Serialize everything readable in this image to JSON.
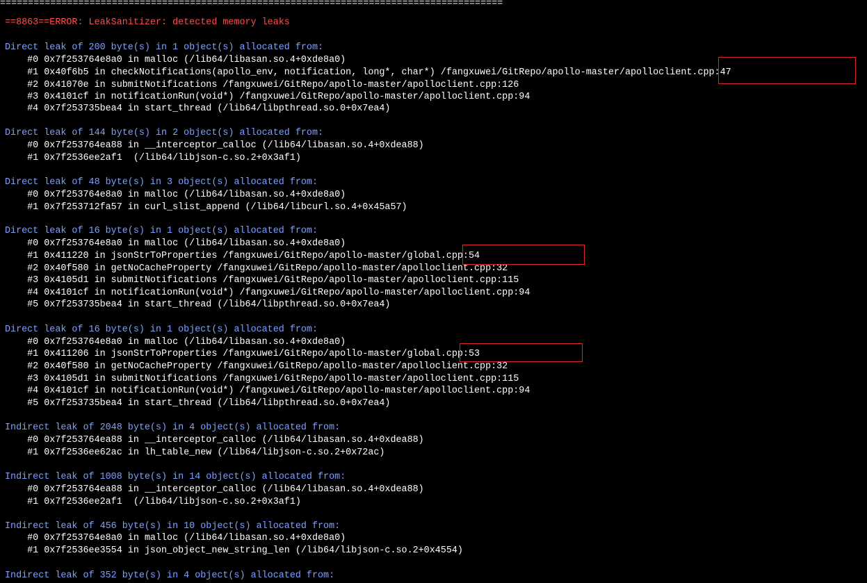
{
  "terminal": {
    "lines": [
      {
        "text": "==========================================================================================",
        "color": "white"
      },
      {
        "text": "==8863==ERROR: LeakSanitizer: detected memory leaks",
        "color": "red"
      },
      {
        "text": "",
        "color": "white"
      },
      {
        "text": "Direct leak of 200 byte(s) in 1 object(s) allocated from:",
        "color": "blue"
      },
      {
        "text": "    #0 0x7f253764e8a0 in malloc (/lib64/libasan.so.4+0xde8a0)",
        "color": "white"
      },
      {
        "text": "    #1 0x40f6b5 in checkNotifications(apollo_env, notification, long*, char*) /fangxuwei/GitRepo/apollo-master/apolloclient.cpp:47",
        "color": "white"
      },
      {
        "text": "    #2 0x41070e in submitNotifications /fangxuwei/GitRepo/apollo-master/apolloclient.cpp:126",
        "color": "white"
      },
      {
        "text": "    #3 0x4101cf in notificationRun(void*) /fangxuwei/GitRepo/apollo-master/apolloclient.cpp:94",
        "color": "white"
      },
      {
        "text": "    #4 0x7f253735bea4 in start_thread (/lib64/libpthread.so.0+0x7ea4)",
        "color": "white"
      },
      {
        "text": "",
        "color": "white"
      },
      {
        "text": "Direct leak of 144 byte(s) in 2 object(s) allocated from:",
        "color": "blue"
      },
      {
        "text": "    #0 0x7f253764ea88 in __interceptor_calloc (/lib64/libasan.so.4+0xdea88)",
        "color": "white"
      },
      {
        "text": "    #1 0x7f2536ee2af1  (/lib64/libjson-c.so.2+0x3af1)",
        "color": "white"
      },
      {
        "text": "",
        "color": "white"
      },
      {
        "text": "Direct leak of 48 byte(s) in 3 object(s) allocated from:",
        "color": "blue"
      },
      {
        "text": "    #0 0x7f253764e8a0 in malloc (/lib64/libasan.so.4+0xde8a0)",
        "color": "white"
      },
      {
        "text": "    #1 0x7f253712fa57 in curl_slist_append (/lib64/libcurl.so.4+0x45a57)",
        "color": "white"
      },
      {
        "text": "",
        "color": "white"
      },
      {
        "text": "Direct leak of 16 byte(s) in 1 object(s) allocated from:",
        "color": "blue"
      },
      {
        "text": "    #0 0x7f253764e8a0 in malloc (/lib64/libasan.so.4+0xde8a0)",
        "color": "white"
      },
      {
        "text": "    #1 0x411220 in jsonStrToProperties /fangxuwei/GitRepo/apollo-master/global.cpp:54",
        "color": "white"
      },
      {
        "text": "    #2 0x40f580 in getNoCacheProperty /fangxuwei/GitRepo/apollo-master/apolloclient.cpp:32",
        "color": "white"
      },
      {
        "text": "    #3 0x4105d1 in submitNotifications /fangxuwei/GitRepo/apollo-master/apolloclient.cpp:115",
        "color": "white"
      },
      {
        "text": "    #4 0x4101cf in notificationRun(void*) /fangxuwei/GitRepo/apollo-master/apolloclient.cpp:94",
        "color": "white"
      },
      {
        "text": "    #5 0x7f253735bea4 in start_thread (/lib64/libpthread.so.0+0x7ea4)",
        "color": "white"
      },
      {
        "text": "",
        "color": "white"
      },
      {
        "text": "Direct leak of 16 byte(s) in 1 object(s) allocated from:",
        "color": "blue"
      },
      {
        "text": "    #0 0x7f253764e8a0 in malloc (/lib64/libasan.so.4+0xde8a0)",
        "color": "white"
      },
      {
        "text": "    #1 0x411206 in jsonStrToProperties /fangxuwei/GitRepo/apollo-master/global.cpp:53",
        "color": "white"
      },
      {
        "text": "    #2 0x40f580 in getNoCacheProperty /fangxuwei/GitRepo/apollo-master/apolloclient.cpp:32",
        "color": "white"
      },
      {
        "text": "    #3 0x4105d1 in submitNotifications /fangxuwei/GitRepo/apollo-master/apolloclient.cpp:115",
        "color": "white"
      },
      {
        "text": "    #4 0x4101cf in notificationRun(void*) /fangxuwei/GitRepo/apollo-master/apolloclient.cpp:94",
        "color": "white"
      },
      {
        "text": "    #5 0x7f253735bea4 in start_thread (/lib64/libpthread.so.0+0x7ea4)",
        "color": "white"
      },
      {
        "text": "",
        "color": "white"
      },
      {
        "text": "Indirect leak of 2048 byte(s) in 4 object(s) allocated from:",
        "color": "blue"
      },
      {
        "text": "    #0 0x7f253764ea88 in __interceptor_calloc (/lib64/libasan.so.4+0xdea88)",
        "color": "white"
      },
      {
        "text": "    #1 0x7f2536ee62ac in lh_table_new (/lib64/libjson-c.so.2+0x72ac)",
        "color": "white"
      },
      {
        "text": "",
        "color": "white"
      },
      {
        "text": "Indirect leak of 1008 byte(s) in 14 object(s) allocated from:",
        "color": "blue"
      },
      {
        "text": "    #0 0x7f253764ea88 in __interceptor_calloc (/lib64/libasan.so.4+0xdea88)",
        "color": "white"
      },
      {
        "text": "    #1 0x7f2536ee2af1  (/lib64/libjson-c.so.2+0x3af1)",
        "color": "white"
      },
      {
        "text": "",
        "color": "white"
      },
      {
        "text": "Indirect leak of 456 byte(s) in 10 object(s) allocated from:",
        "color": "blue"
      },
      {
        "text": "    #0 0x7f253764e8a0 in malloc (/lib64/libasan.so.4+0xde8a0)",
        "color": "white"
      },
      {
        "text": "    #1 0x7f2536ee3554 in json_object_new_string_len (/lib64/libjson-c.so.2+0x4554)",
        "color": "white"
      },
      {
        "text": "",
        "color": "white"
      },
      {
        "text": "Indirect leak of 352 byte(s) in 4 object(s) allocated from:",
        "color": "blue"
      }
    ]
  },
  "highlight_color": "#e1252f"
}
